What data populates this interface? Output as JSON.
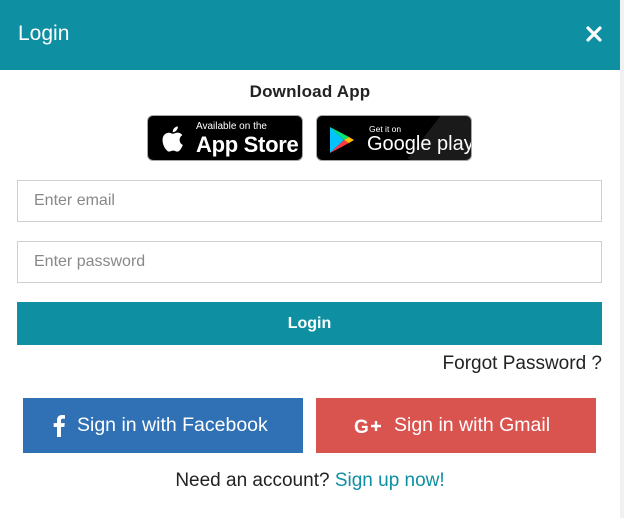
{
  "header": {
    "title": "Login",
    "close_icon": "close-icon",
    "color": "#0e8fa2"
  },
  "download": {
    "title": "Download App",
    "app_store": {
      "small_text": "Available on the",
      "big_text": "App Store",
      "icon": "apple-icon"
    },
    "google_play": {
      "small_text": "Get it on",
      "big_text": "Google play",
      "icon": "google-play-icon"
    }
  },
  "form": {
    "email_placeholder": "Enter email",
    "email_value": "",
    "password_placeholder": "Enter password",
    "password_value": "",
    "login_label": "Login",
    "forgot_label": "Forgot Password ?"
  },
  "social": {
    "facebook_label": "Sign in with Facebook",
    "facebook_icon": "facebook-icon",
    "facebook_color": "#3070b5",
    "gmail_label": "Sign in with Gmail",
    "gmail_icon": "google-plus-icon",
    "gmail_color": "#d9534f"
  },
  "signup": {
    "prompt": "Need an account?",
    "link_label": "Sign up now!"
  }
}
